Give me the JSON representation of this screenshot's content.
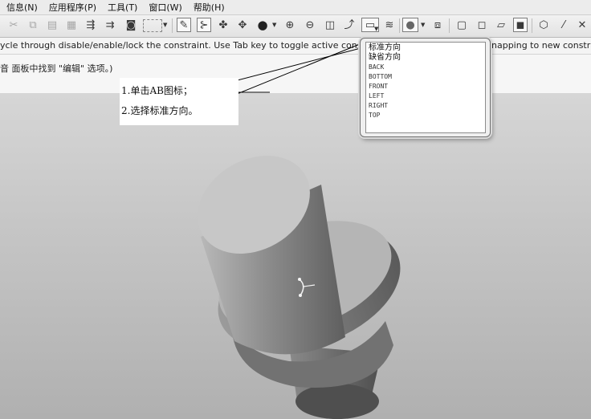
{
  "menu": [
    {
      "label": "信息(N)"
    },
    {
      "label": "应用程序(P)"
    },
    {
      "label": "工具(T)"
    },
    {
      "label": "窗口(W)"
    },
    {
      "label": "帮助(H)"
    }
  ],
  "message_bar": {
    "text_left": "ycle through disable/enable/lock the constraint. Use Tab key to toggle active constraint.",
    "text_right": "napping to new constrai"
  },
  "hint_bar": {
    "text": "音 面板中找到 \"编辑\" 选项。)"
  },
  "callout": {
    "step1": "1.单击AB图标；",
    "step2": "2.选择标准方向。"
  },
  "orientation_popup": {
    "options": [
      "标准方向",
      "缺省方向",
      "BACK",
      "BOTTOM",
      "FRONT",
      "LEFT",
      "RIGHT",
      "TOP"
    ]
  },
  "colors": {
    "accent_line": "#000000",
    "viewport_top": "#d6d6d6",
    "viewport_bottom": "#b0b0b0"
  }
}
